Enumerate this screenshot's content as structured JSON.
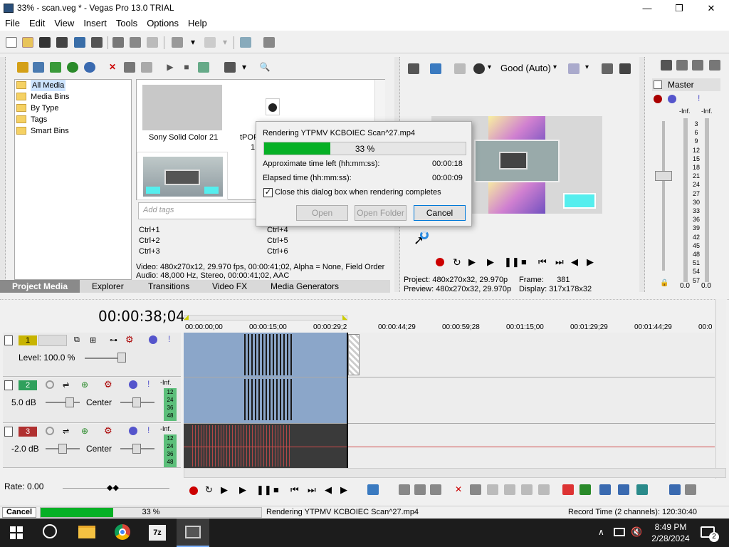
{
  "window": {
    "title": "33% - scan.veg * - Vegas Pro 13.0 TRIAL",
    "minimize": "—",
    "maximize": "❐",
    "close": "✕"
  },
  "menu": [
    "File",
    "Edit",
    "View",
    "Insert",
    "Tools",
    "Options",
    "Help"
  ],
  "project_media": {
    "tree": [
      "All Media",
      "Media Bins",
      "By Type",
      "Tags",
      "Smart Bins"
    ],
    "tree_expander": "+",
    "thumbs": [
      "Sony Solid Color 21",
      "tPOR",
      "1"
    ],
    "tags_placeholder": "Add tags",
    "hotkeys": [
      "Ctrl+1",
      "Ctrl+4",
      "Ctrl+2",
      "Ctrl+5",
      "Ctrl+3",
      "Ctrl+6"
    ],
    "info_line1": "Video: 480x270x12, 29.970 fps, 00:00:41;02, Alpha = None, Field Order",
    "info_line2": "Audio: 48,000 Hz, Stereo, 00:00:41;02, AAC",
    "tabs": [
      "Project Media",
      "Explorer",
      "Transitions",
      "Video FX",
      "Media Generators"
    ]
  },
  "preview": {
    "quality": "Good (Auto)",
    "project_label": "Project:",
    "project_value": "480x270x32, 29.970p",
    "preview_label": "Preview:",
    "preview_value": "480x270x32, 29.970p",
    "frame_label": "Frame:",
    "frame_value": "381",
    "display_label": "Display:",
    "display_value": "317x178x32"
  },
  "master": {
    "label": "Master",
    "inf_left": "-Inf.",
    "inf_right": "-Inf.",
    "scale": [
      "3",
      "6",
      "9",
      "12",
      "15",
      "18",
      "21",
      "24",
      "27",
      "30",
      "33",
      "36",
      "39",
      "42",
      "45",
      "48",
      "51",
      "54",
      "57"
    ],
    "val_left": "0.0",
    "val_right": "0.0"
  },
  "dialog": {
    "title": "Rendering YTPMV KCBOIEC Scan^27.mp4",
    "progress_label": "33 %",
    "progress": 0.33,
    "time_left_label": "Approximate time left (hh:mm:ss):",
    "time_left": "00:00:18",
    "elapsed_label": "Elapsed time (hh:mm:ss):",
    "elapsed": "00:00:09",
    "checkbox_label": "Close this dialog box when rendering completes",
    "checkbox_checked": true,
    "open_button": "Open",
    "open_folder_button": "Open Folder",
    "cancel_button": "Cancel"
  },
  "timeline": {
    "timecode": "00:00:38;04",
    "ruler": [
      "00:00:00;00",
      "00:00:15;00",
      "00:00:29;2",
      "00:00:44;29",
      "00:00:59;28",
      "00:01:15;00",
      "00:01:29;29",
      "00:01:44;29",
      "00:0"
    ],
    "tracks": [
      {
        "num": "1",
        "color": "#c8b400",
        "level_label": "Level: 100.0 %"
      },
      {
        "num": "2",
        "color": "#2fa05c",
        "vol": "5.0 dB",
        "pan": "Center",
        "inf": "-Inf.",
        "meter": [
          "12",
          "24",
          "36",
          "48"
        ]
      },
      {
        "num": "3",
        "color": "#b03030",
        "vol": "-2.0 dB",
        "pan": "Center",
        "inf": "-Inf.",
        "meter": [
          "12",
          "24",
          "36",
          "48"
        ]
      }
    ],
    "rate_label": "Rate: 0.00"
  },
  "status": {
    "cancel_button": "Cancel",
    "progress_label": "33 %",
    "progress": 0.33,
    "message": "Rendering YTPMV KCBOIEC Scan^27.mp4",
    "record_time": "Record Time (2 channels): 120:30:40"
  },
  "taskbar": {
    "time": "8:49 PM",
    "date": "2/28/2024",
    "notif_count": "2"
  },
  "colors": {
    "accent_green": "#1db32a",
    "window_bg": "#f0f0f0",
    "event_blue": "#8fa8c8"
  }
}
